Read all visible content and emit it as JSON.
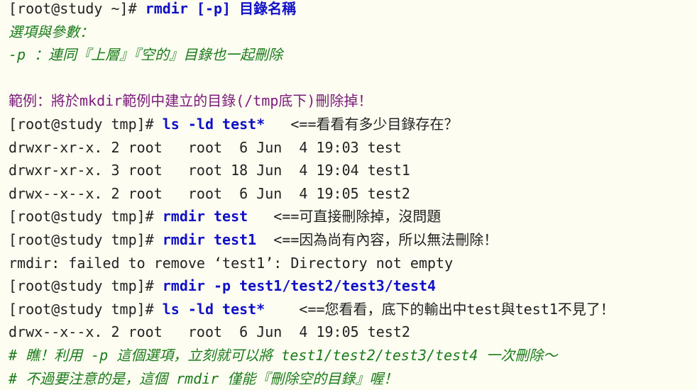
{
  "syntax": {
    "prompt": "[root@study ~]# ",
    "command": "rmdir [-p] 目錄名稱"
  },
  "options": {
    "heading": "選項與參數：",
    "p_option": "-p ：連同『上層』『空的』目錄也一起刪除"
  },
  "example": {
    "title": "範例：將於mkdir範例中建立的目錄(/tmp底下)刪除掉！"
  },
  "session": [
    {
      "type": "cmd",
      "prompt": "[root@study tmp]# ",
      "command": "ls -ld test*",
      "note": "   <==看看有多少目錄存在？"
    },
    {
      "type": "out",
      "text": "drwxr-xr-x. 2 root   root  6 Jun  4 19:03 test"
    },
    {
      "type": "out",
      "text": "drwxr-xr-x. 3 root   root 18 Jun  4 19:04 test1"
    },
    {
      "type": "out",
      "text": "drwx--x--x. 2 root   root  6 Jun  4 19:05 test2"
    },
    {
      "type": "cmd",
      "prompt": "[root@study tmp]# ",
      "command": "rmdir test",
      "note": "   <==可直接刪除掉，沒問題"
    },
    {
      "type": "cmd",
      "prompt": "[root@study tmp]# ",
      "command": "rmdir test1",
      "note": "  <==因為尚有內容，所以無法刪除！"
    },
    {
      "type": "out",
      "text": "rmdir: failed to remove ‘test1’: Directory not empty"
    },
    {
      "type": "cmd",
      "prompt": "[root@study tmp]# ",
      "command": "rmdir -p test1/test2/test3/test4",
      "note": ""
    },
    {
      "type": "cmd",
      "prompt": "[root@study tmp]# ",
      "command": "ls -ld test*",
      "note": "    <==您看看，底下的輸出中test與test1不見了！"
    },
    {
      "type": "out",
      "text": "drwx--x--x. 2 root   root  6 Jun  4 19:05 test2"
    }
  ],
  "comments": [
    "# 瞧！利用 -p 這個選項，立刻就可以將 test1/test2/test3/test4 一次刪除～",
    "# 不過要注意的是，這個 rmdir 僅能『刪除空的目錄』喔！"
  ]
}
